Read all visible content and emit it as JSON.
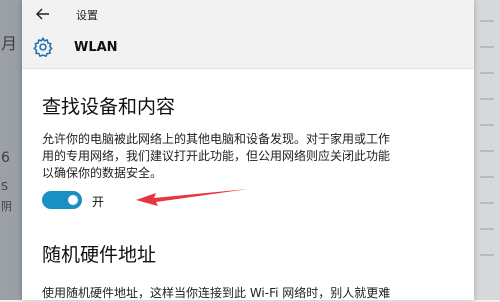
{
  "background_left": {
    "fragments": [
      "月",
      "6",
      "S",
      "阴"
    ]
  },
  "titlebar": {
    "title": "设置"
  },
  "header": {
    "title": "WLAN"
  },
  "discovery": {
    "heading": "查找设备和内容",
    "description_lines": [
      "允许你的电脑被此网络上的其他电脑和设备发现。对于家用或工作",
      "用的专用网络，我们建议打开此功能，但公用网络则应关闭此功能",
      "以确保你的数据安全。"
    ],
    "toggle": {
      "state_label": "开",
      "on": true
    }
  },
  "random_address": {
    "heading": "随机硬件地址",
    "description": "使用随机硬件地址，这样当你连接到此 Wi-Fi 网络时，别人就更难"
  },
  "colors": {
    "accent": "#1a8fc4",
    "annotation_arrow": "#e8343a",
    "window_bg": "#ffffff",
    "header_bg": "#f2f2f2"
  },
  "icons": {
    "back": "back-arrow-icon",
    "settings": "gear-icon",
    "annotation": "red-arrow-annotation"
  }
}
